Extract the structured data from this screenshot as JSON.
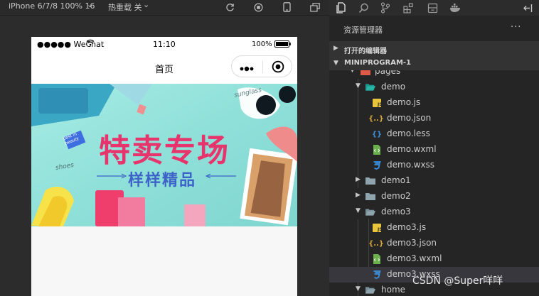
{
  "simulator": {
    "device": "iPhone 6/7/8 100% 16",
    "device_caret": "⌄",
    "hot_reload": "热重载 关",
    "hot_reload_caret": "⌄",
    "status": {
      "carrier": "●●●●● WeChat",
      "time": "11:10",
      "battery": "100%"
    },
    "page_title": "首页",
    "banner": {
      "headline": "特卖专场",
      "subline": "样样精品",
      "sunglass_note": "sunglass",
      "tag_note": "best in beauty",
      "shoe_note": "shoes"
    }
  },
  "explorer": {
    "title": "资源管理器",
    "more": "···",
    "open_editors": "打开的编辑器",
    "project": "MINIPROGRAM-1",
    "tree": [
      {
        "name": "pages",
        "type": "folder",
        "expanded": true
      },
      {
        "name": "demo",
        "type": "folder",
        "expanded": true
      },
      {
        "name": "demo.js",
        "type": "js"
      },
      {
        "name": "demo.json",
        "type": "json"
      },
      {
        "name": "demo.less",
        "type": "less"
      },
      {
        "name": "demo.wxml",
        "type": "wxml"
      },
      {
        "name": "demo.wxss",
        "type": "wxss"
      },
      {
        "name": "demo1",
        "type": "folder",
        "expanded": false
      },
      {
        "name": "demo2",
        "type": "folder",
        "expanded": false
      },
      {
        "name": "demo3",
        "type": "folder",
        "expanded": true
      },
      {
        "name": "demo3.js",
        "type": "js"
      },
      {
        "name": "demo3.json",
        "type": "json"
      },
      {
        "name": "demo3.wxml",
        "type": "wxml"
      },
      {
        "name": "demo3.wxss",
        "type": "wxss",
        "selected": true
      },
      {
        "name": "home",
        "type": "folder",
        "expanded": true
      }
    ]
  },
  "watermark": "CSDN @Super咩咩",
  "colors": {
    "js": "#e8c33c",
    "json": "#d6a93a",
    "less": "#3b8fde",
    "wxml": "#6ab04c",
    "wxss": "#3b8fde",
    "folder": "#90a4ae",
    "headline": "#e7346c",
    "subline": "#3d63c8",
    "banner_bg": "#8ee0d8"
  }
}
